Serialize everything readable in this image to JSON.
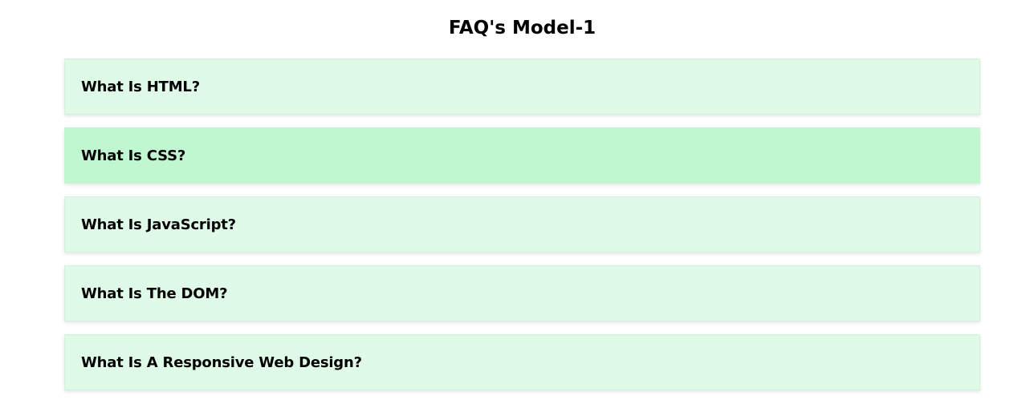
{
  "page": {
    "title": "FAQ's Model-1"
  },
  "faq": {
    "items": [
      {
        "question": "What Is HTML?",
        "active": false
      },
      {
        "question": "What Is CSS?",
        "active": true
      },
      {
        "question": "What Is JavaScript?",
        "active": false
      },
      {
        "question": "What Is The DOM?",
        "active": false
      },
      {
        "question": "What Is A Responsive Web Design?",
        "active": false
      }
    ]
  },
  "colors": {
    "item_background": "#dffbe8",
    "item_active_background": "#c0f6d0",
    "text": "#000000"
  }
}
